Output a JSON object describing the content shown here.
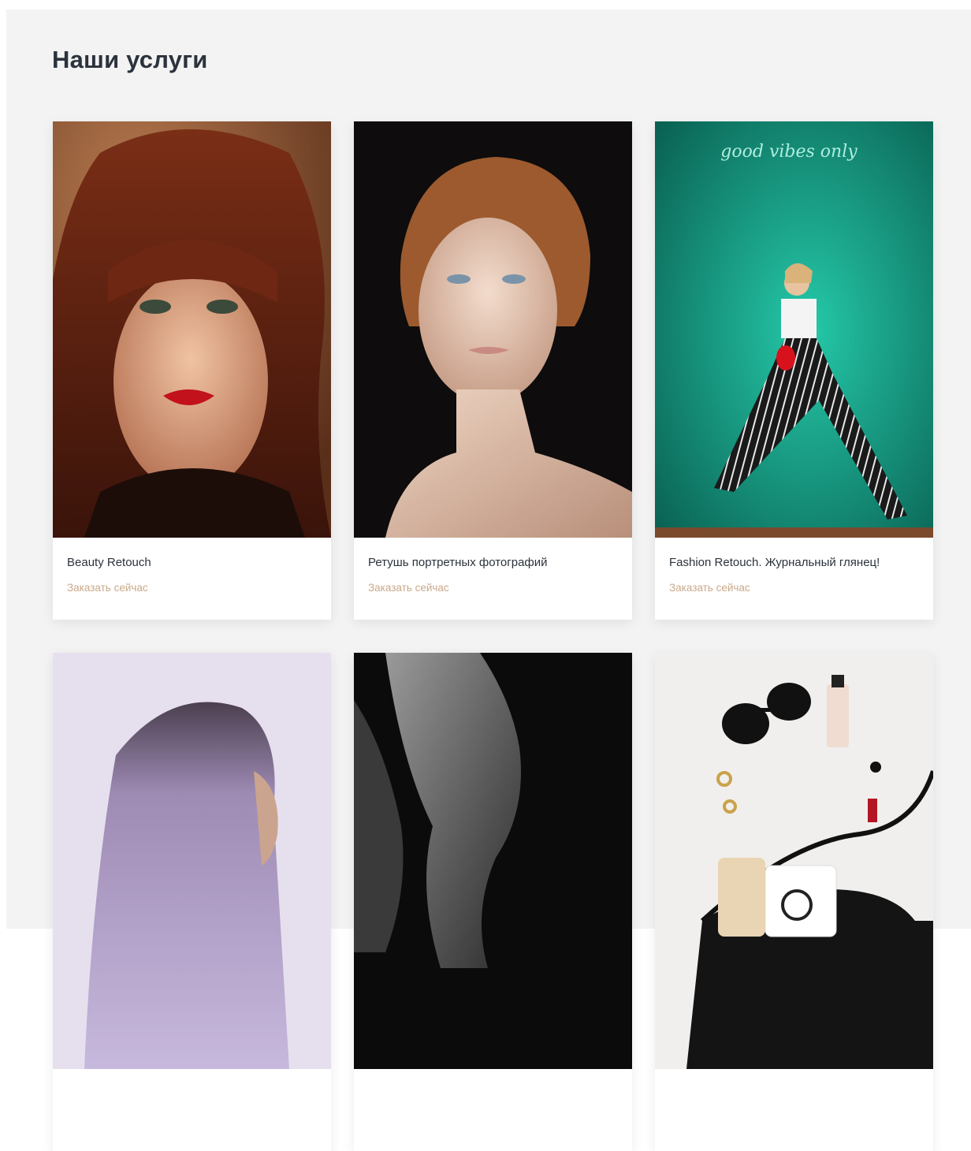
{
  "section": {
    "title": "Наши услуги"
  },
  "cards": [
    {
      "title": "Beauty Retouch",
      "cta": "Заказать сейчас"
    },
    {
      "title": "Ретушь портретных фотографий",
      "cta": "Заказать сейчас"
    },
    {
      "title": "Fashion Retouch. Журнальный глянец!",
      "cta": "Заказать сейчас"
    },
    {
      "title": "",
      "cta": ""
    },
    {
      "title": "",
      "cta": ""
    },
    {
      "title": "",
      "cta": ""
    }
  ],
  "colors": {
    "section_bg": "#f3f3f3",
    "heading": "#2b333d",
    "cta": "#c9a98a",
    "card_bg": "#ffffff"
  }
}
